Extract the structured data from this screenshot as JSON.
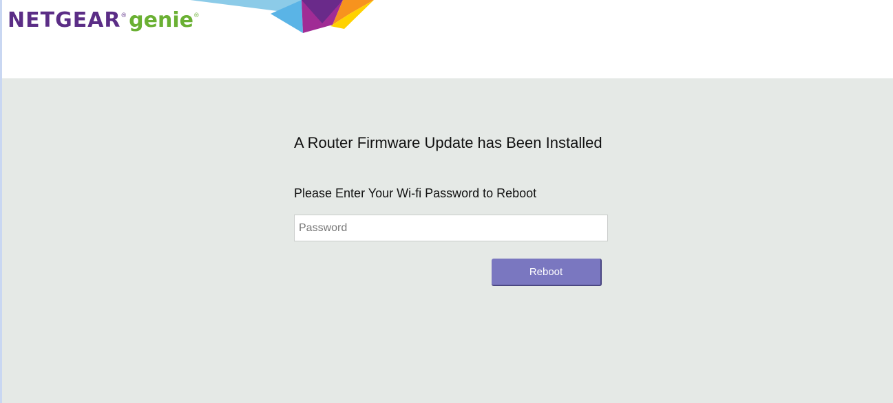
{
  "header": {
    "logo": {
      "brand": "NETGEAR",
      "product": "genie",
      "registered_mark": "®",
      "brand_color": "#5b2d86",
      "product_color": "#6ab033"
    }
  },
  "main": {
    "heading": "A Router Firmware Update has Been Installed",
    "prompt": "Please Enter Your Wi-fi Password to Reboot",
    "password": {
      "value": "",
      "placeholder": "Password"
    },
    "reboot_label": "Reboot"
  },
  "colors": {
    "background": "#e5e9e6",
    "button": "#7a77c0",
    "button_shadow": "#4b4782"
  }
}
